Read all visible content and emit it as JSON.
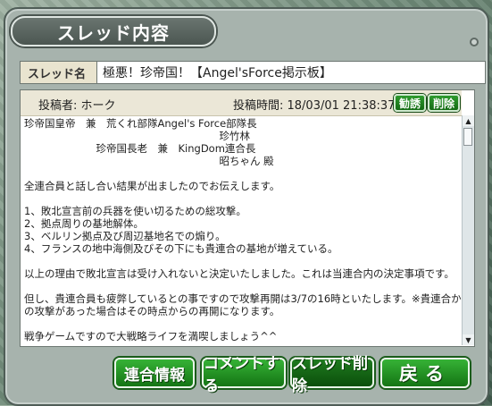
{
  "window": {
    "title": "スレッド内容"
  },
  "thread": {
    "subject_label": "スレッド名",
    "subject_value": "極悪！珍帝国！【Angel'sForce掲示板】"
  },
  "post": {
    "poster": "投稿者: ホーク",
    "time": "投稿時間: 18/03/01 21:38:37",
    "invite_label": "勧誘",
    "delete_label": "削除",
    "body": "珍帝国皇帝　兼　荒くれ部隊Angel's Force部隊長\n　　　　　　　　　　　　　　　　　　　珍竹林\n　　　　　　　珍帝国長老　兼　KingDom連合長\n　　　　　　　　　　　　　　　　　　　昭ちゃん 殿\n\n全連合員と話し合い結果が出ましたのでお伝えします。\n\n1、敗北宣言前の兵器を使い切るための総攻撃。\n2、拠点周りの基地解体。\n3、ベルリン拠点及び周辺基地名での煽り。\n4、フランスの地中海側及びその下にも貴連合の基地が増えている。\n\n以上の理由で敗北宣言は受け入れないと決定いたしました。これは当連合内の決定事項です。\n\n但し、貴連合員も疲弊しているとの事ですので攻撃再開は3/7の16時といたします。※貴連合から\nの攻撃があった場合はその時点からの再開になります。\n\n戦争ゲームですので大戦略ライフを満喫しましょう^^"
  },
  "buttons": {
    "alliance_info": "連合情報",
    "comment": "コメントする",
    "delete_thread": "スレッド削除",
    "back": "戻る"
  }
}
